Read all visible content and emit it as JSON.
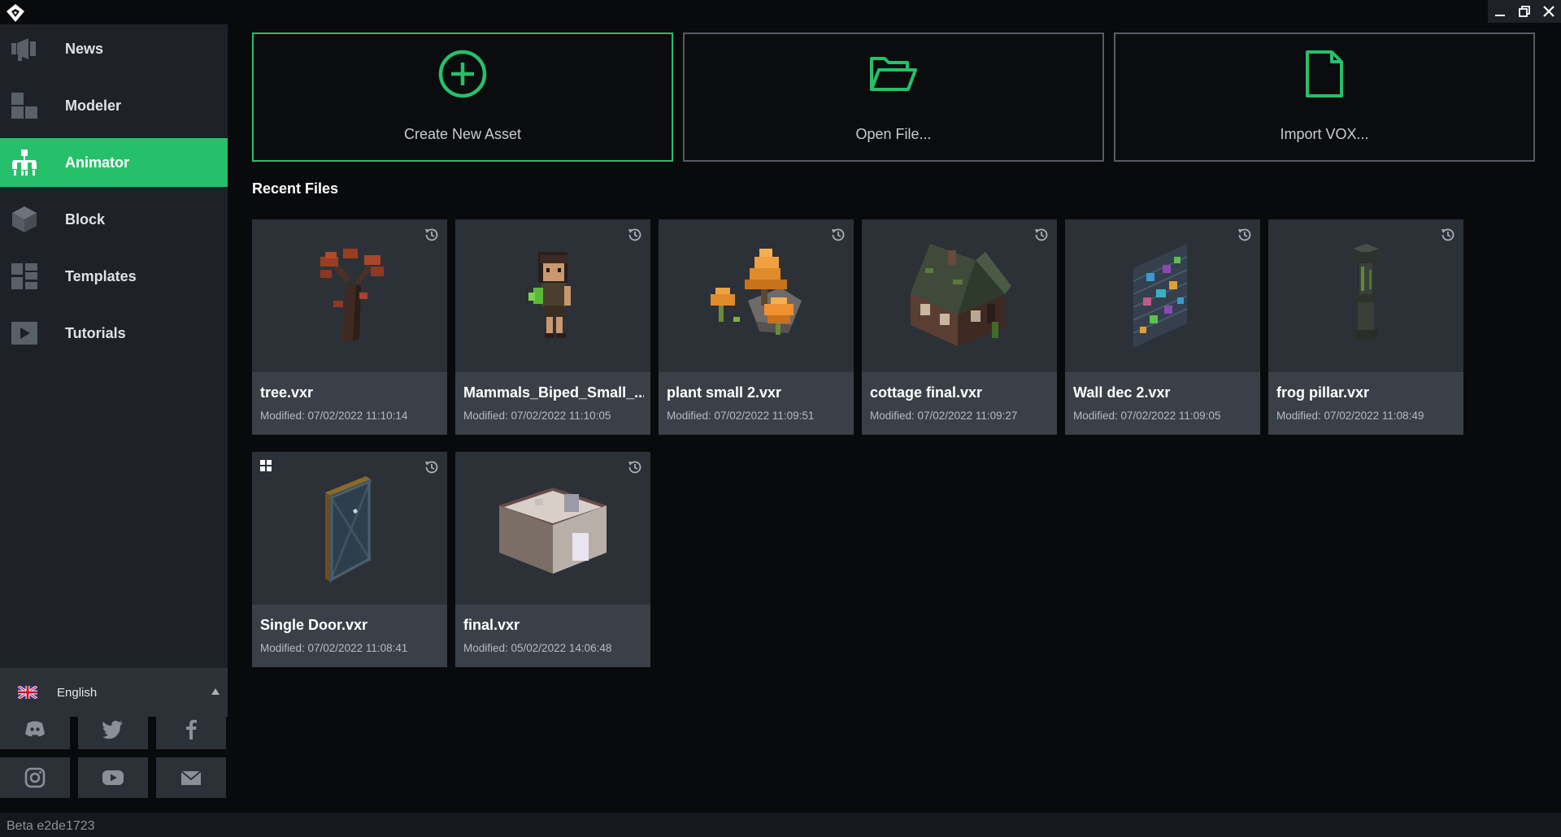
{
  "statusbar": {
    "version": "Beta e2de1723"
  },
  "sidebar": {
    "items": [
      {
        "label": "News",
        "icon": "megaphone-icon"
      },
      {
        "label": "Modeler",
        "icon": "modeler-icon"
      },
      {
        "label": "Animator",
        "icon": "rig-icon",
        "active": true
      },
      {
        "label": "Block",
        "icon": "cube-icon"
      },
      {
        "label": "Templates",
        "icon": "templates-icon"
      },
      {
        "label": "Tutorials",
        "icon": "play-icon"
      }
    ],
    "language": {
      "label": "English",
      "flag": "uk-flag-icon"
    },
    "social": [
      "discord-icon",
      "twitter-icon",
      "facebook-icon",
      "instagram-icon",
      "youtube-icon",
      "mail-icon"
    ]
  },
  "actions": {
    "create": {
      "label": "Create New Asset",
      "icon": "plus-circle-icon"
    },
    "open": {
      "label": "Open File...",
      "icon": "folder-open-icon"
    },
    "import": {
      "label": "Import VOX...",
      "icon": "file-icon"
    }
  },
  "recent": {
    "title": "Recent Files",
    "files": [
      {
        "name": "tree.vxr",
        "modified": "Modified: 07/02/2022 11:10:14"
      },
      {
        "name": "Mammals_Biped_Small_...",
        "modified": "Modified: 07/02/2022 11:10:05"
      },
      {
        "name": "plant small 2.vxr",
        "modified": "Modified: 07/02/2022 11:09:51"
      },
      {
        "name": "cottage final.vxr",
        "modified": "Modified: 07/02/2022 11:09:27"
      },
      {
        "name": "Wall dec 2.vxr",
        "modified": "Modified: 07/02/2022 11:09:05"
      },
      {
        "name": "frog pillar.vxr",
        "modified": "Modified: 07/02/2022 11:08:49"
      },
      {
        "name": "Single Door.vxr",
        "modified": "Modified: 07/02/2022 11:08:41"
      },
      {
        "name": "final.vxr",
        "modified": "Modified: 05/02/2022 14:06:48"
      }
    ]
  },
  "colors": {
    "accent": "#27c06a",
    "sidebar": "#1e2228",
    "background": "#090a0c"
  }
}
